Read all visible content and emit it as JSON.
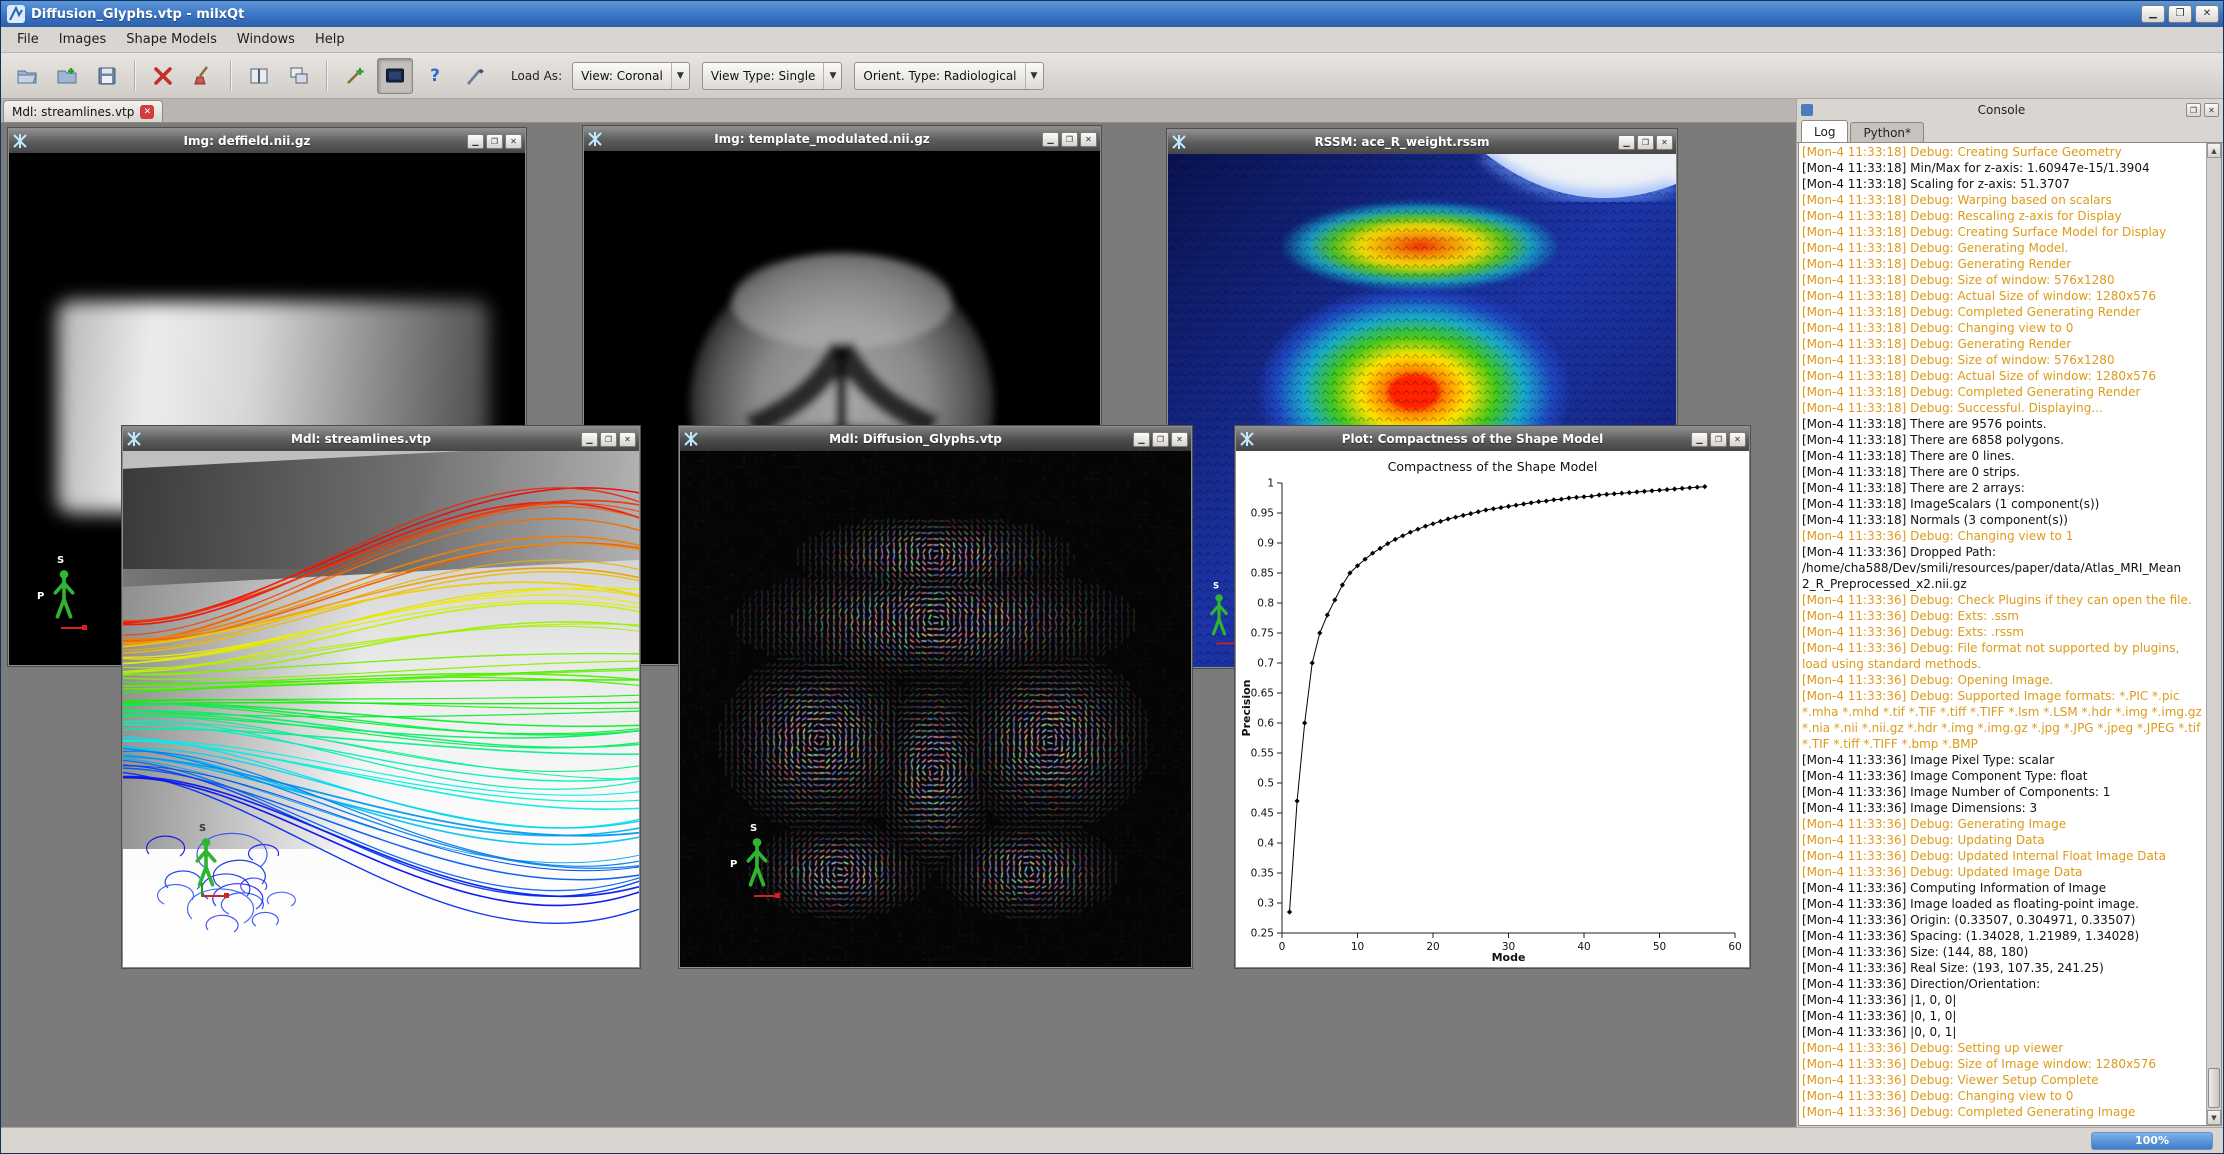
{
  "window": {
    "title": "Diffusion_Glyphs.vtp - milxQt"
  },
  "menu": {
    "items": [
      "File",
      "Images",
      "Shape Models",
      "Windows",
      "Help"
    ]
  },
  "toolbar": {
    "load_as_label": "Load As:",
    "combos": [
      {
        "label": "View: Coronal"
      },
      {
        "label": "View Type: Single"
      },
      {
        "label": "Orient. Type: Radiological"
      }
    ]
  },
  "tabs": [
    {
      "label": "Mdl: streamlines.vtp"
    }
  ],
  "mdi": {
    "windows": [
      {
        "id": "deffield",
        "title": "Img: deffield.nii.gz"
      },
      {
        "id": "template",
        "title": "Img: template_modulated.nii.gz"
      },
      {
        "id": "rssm",
        "title": "RSSM: ace_R_weight.rssm"
      },
      {
        "id": "streamlines",
        "title": "Mdl: streamlines.vtp"
      },
      {
        "id": "glyphs",
        "title": "Mdl: Diffusion_Glyphs.vtp"
      },
      {
        "id": "plot",
        "title": "Plot: Compactness of the Shape Model"
      }
    ],
    "orientation_labels": {
      "s": "S",
      "p": "P"
    }
  },
  "console": {
    "title": "Console",
    "tabs": [
      {
        "label": "Log",
        "selected": true
      },
      {
        "label": "Python*",
        "selected": false
      }
    ],
    "log": [
      {
        "t": "[Mon-4 11:33:18] Debug: Creating Surface Geometry",
        "c": "o"
      },
      {
        "t": "[Mon-4 11:33:18] Min/Max for z-axis: 1.60947e-15/1.3904",
        "c": "k"
      },
      {
        "t": "[Mon-4 11:33:18] Scaling for z-axis: 51.3707",
        "c": "k"
      },
      {
        "t": "[Mon-4 11:33:18] Debug: Warping based on scalars",
        "c": "o"
      },
      {
        "t": "[Mon-4 11:33:18] Debug: Rescaling z-axis for Display",
        "c": "o"
      },
      {
        "t": "[Mon-4 11:33:18] Debug: Creating Surface Model for Display",
        "c": "o"
      },
      {
        "t": "[Mon-4 11:33:18] Debug: Generating Model.",
        "c": "o"
      },
      {
        "t": "[Mon-4 11:33:18] Debug: Generating Render",
        "c": "o"
      },
      {
        "t": "[Mon-4 11:33:18] Debug: Size of window: 576x1280",
        "c": "o"
      },
      {
        "t": "[Mon-4 11:33:18] Debug: Actual Size of window: 1280x576",
        "c": "o"
      },
      {
        "t": "[Mon-4 11:33:18] Debug: Completed Generating Render",
        "c": "o"
      },
      {
        "t": "[Mon-4 11:33:18] Debug: Changing view to 0",
        "c": "o"
      },
      {
        "t": "[Mon-4 11:33:18] Debug: Generating Render",
        "c": "o"
      },
      {
        "t": "[Mon-4 11:33:18] Debug: Size of window: 576x1280",
        "c": "o"
      },
      {
        "t": "[Mon-4 11:33:18] Debug: Actual Size of window: 1280x576",
        "c": "o"
      },
      {
        "t": "[Mon-4 11:33:18] Debug: Completed Generating Render",
        "c": "o"
      },
      {
        "t": "[Mon-4 11:33:18] Debug: Successful. Displaying...",
        "c": "o"
      },
      {
        "t": "[Mon-4 11:33:18] There are 9576 points.",
        "c": "k"
      },
      {
        "t": "[Mon-4 11:33:18] There are 6858 polygons.",
        "c": "k"
      },
      {
        "t": "[Mon-4 11:33:18] There are 0 lines.",
        "c": "k"
      },
      {
        "t": "[Mon-4 11:33:18] There are 0 strips.",
        "c": "k"
      },
      {
        "t": "[Mon-4 11:33:18] There are 2 arrays:",
        "c": "k"
      },
      {
        "t": "[Mon-4 11:33:18] ImageScalars (1 component(s))",
        "c": "k"
      },
      {
        "t": "[Mon-4 11:33:18] Normals (3 component(s))",
        "c": "k"
      },
      {
        "t": "[Mon-4 11:33:36] Debug: Changing view to 1",
        "c": "o"
      },
      {
        "t": "[Mon-4 11:33:36] Dropped Path:",
        "c": "k"
      },
      {
        "t": "/home/cha588/Dev/smili/resources/paper/data/Atlas_MRI_Mean",
        "c": "k"
      },
      {
        "t": "2_R_Preprocessed_x2.nii.gz",
        "c": "k"
      },
      {
        "t": "[Mon-4 11:33:36] Debug: Check Plugins if they can open the file.",
        "c": "o"
      },
      {
        "t": "[Mon-4 11:33:36] Debug: Exts: .ssm",
        "c": "o"
      },
      {
        "t": "[Mon-4 11:33:36] Debug: Exts: .rssm",
        "c": "o"
      },
      {
        "t": "[Mon-4 11:33:36] Debug: File format not supported by plugins,",
        "c": "o"
      },
      {
        "t": "load using standard methods.",
        "c": "o"
      },
      {
        "t": "[Mon-4 11:33:36] Debug: Opening Image.",
        "c": "o"
      },
      {
        "t": "[Mon-4 11:33:36] Debug: Supported Image formats: *.PIC *.pic",
        "c": "o"
      },
      {
        "t": "*.mha *.mhd *.tif *.TIF *.tiff *.TIFF *.lsm *.LSM *.hdr *.img *.img.gz",
        "c": "o"
      },
      {
        "t": "*.nia *.nii *.nii.gz *.hdr *.img *.img.gz *.jpg *.JPG *.jpeg *.JPEG *.tif",
        "c": "o"
      },
      {
        "t": "*.TIF *.tiff *.TIFF *.bmp *.BMP",
        "c": "o"
      },
      {
        "t": "[Mon-4 11:33:36] Image Pixel Type: scalar",
        "c": "k"
      },
      {
        "t": "[Mon-4 11:33:36] Image Component Type: float",
        "c": "k"
      },
      {
        "t": "[Mon-4 11:33:36] Image Number of Components: 1",
        "c": "k"
      },
      {
        "t": "[Mon-4 11:33:36] Image Dimensions: 3",
        "c": "k"
      },
      {
        "t": "[Mon-4 11:33:36] Debug: Generating Image",
        "c": "o"
      },
      {
        "t": "[Mon-4 11:33:36] Debug: Updating Data",
        "c": "o"
      },
      {
        "t": "[Mon-4 11:33:36] Debug: Updated Internal Float Image Data",
        "c": "o"
      },
      {
        "t": "[Mon-4 11:33:36] Debug: Updated Image Data",
        "c": "o"
      },
      {
        "t": "[Mon-4 11:33:36] Computing Information of Image",
        "c": "k"
      },
      {
        "t": "[Mon-4 11:33:36] Image loaded as floating-point image.",
        "c": "k"
      },
      {
        "t": "[Mon-4 11:33:36] Origin: (0.33507, 0.304971, 0.33507)",
        "c": "k"
      },
      {
        "t": "[Mon-4 11:33:36] Spacing: (1.34028, 1.21989, 1.34028)",
        "c": "k"
      },
      {
        "t": "[Mon-4 11:33:36] Size: (144, 88, 180)",
        "c": "k"
      },
      {
        "t": "[Mon-4 11:33:36] Real Size: (193, 107.35, 241.25)",
        "c": "k"
      },
      {
        "t": "[Mon-4 11:33:36] Direction/Orientation:",
        "c": "k"
      },
      {
        "t": "[Mon-4 11:33:36] |1, 0, 0|",
        "c": "k"
      },
      {
        "t": "[Mon-4 11:33:36] |0, 1, 0|",
        "c": "k"
      },
      {
        "t": "[Mon-4 11:33:36] |0, 0, 1|",
        "c": "k"
      },
      {
        "t": "[Mon-4 11:33:36] Debug: Setting up viewer",
        "c": "o"
      },
      {
        "t": "[Mon-4 11:33:36] Debug: Size of Image window: 1280x576",
        "c": "o"
      },
      {
        "t": "[Mon-4 11:33:36] Debug: Viewer Setup Complete",
        "c": "o"
      },
      {
        "t": "[Mon-4 11:33:36] Debug: Changing view to 0",
        "c": "o"
      },
      {
        "t": "[Mon-4 11:33:36] Debug: Completed Generating Image",
        "c": "o"
      }
    ]
  },
  "statusbar": {
    "progress": "100%"
  },
  "colors": {
    "titlebar_blue": "#3a74c4",
    "log_warning_orange": "#dd9a1a",
    "progress_blue": "#3f7cc9",
    "mdi_background": "#7b7b7b"
  },
  "chart_data": {
    "type": "line",
    "title": "Compactness of the Shape Model",
    "xlabel": "Mode",
    "ylabel": "Precision",
    "xlim": [
      0,
      60
    ],
    "ylim": [
      0.25,
      1.0
    ],
    "x_ticks": [
      0,
      10,
      20,
      30,
      40,
      50,
      60
    ],
    "y_ticks": [
      0.25,
      0.3,
      0.35,
      0.4,
      0.45,
      0.5,
      0.55,
      0.6,
      0.65,
      0.7,
      0.75,
      0.8,
      0.85,
      0.9,
      0.95,
      1
    ],
    "y_tick_labels": [
      "0.25",
      "0.3",
      "0.35",
      "0.4",
      "0.45",
      "0.5",
      "0.55",
      "0.6",
      "0.65",
      "0.7",
      "0.75",
      "0.8",
      "0.85",
      "0.9",
      "0.95",
      "1"
    ],
    "x": [
      1,
      2,
      3,
      4,
      5,
      6,
      7,
      8,
      9,
      10,
      11,
      12,
      13,
      14,
      15,
      16,
      17,
      18,
      19,
      20,
      21,
      22,
      23,
      24,
      25,
      26,
      27,
      28,
      29,
      30,
      31,
      32,
      33,
      34,
      35,
      36,
      37,
      38,
      39,
      40,
      41,
      42,
      43,
      44,
      45,
      46,
      47,
      48,
      49,
      50,
      51,
      52,
      53,
      54,
      55,
      56
    ],
    "y": [
      0.285,
      0.47,
      0.6,
      0.7,
      0.75,
      0.78,
      0.805,
      0.83,
      0.85,
      0.862,
      0.873,
      0.883,
      0.891,
      0.899,
      0.906,
      0.912,
      0.918,
      0.923,
      0.928,
      0.932,
      0.936,
      0.94,
      0.943,
      0.946,
      0.949,
      0.952,
      0.955,
      0.957,
      0.959,
      0.961,
      0.963,
      0.965,
      0.967,
      0.969,
      0.97,
      0.972,
      0.973,
      0.975,
      0.976,
      0.977,
      0.978,
      0.98,
      0.981,
      0.982,
      0.983,
      0.984,
      0.985,
      0.986,
      0.987,
      0.988,
      0.989,
      0.99,
      0.991,
      0.992,
      0.993,
      0.994
    ],
    "marker": "diamond",
    "grid": false,
    "legend": "none"
  }
}
